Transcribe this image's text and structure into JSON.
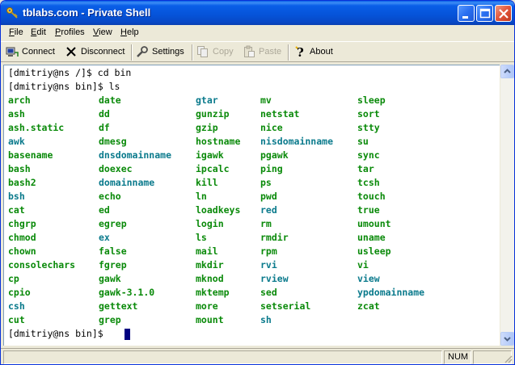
{
  "window": {
    "title": "tblabs.com - Private Shell",
    "key_icon": "key-icon"
  },
  "menu": [
    {
      "label_first": "F",
      "label_rest": "ile"
    },
    {
      "label_first": "E",
      "label_rest": "dit"
    },
    {
      "label_first": "P",
      "label_rest": "rofiles"
    },
    {
      "label_first": "V",
      "label_rest": "iew"
    },
    {
      "label_first": "H",
      "label_rest": "elp"
    }
  ],
  "toolbar": {
    "connect": "Connect",
    "disconnect": "Disconnect",
    "settings": "Settings",
    "copy": "Copy",
    "paste": "Paste",
    "about": "About"
  },
  "terminal": {
    "line1": "[dmitriy@ns /]$ cd bin",
    "line2": "[dmitriy@ns bin]$ ls",
    "prompt": "[dmitriy@ns bin]$ ",
    "listing": [
      [
        {
          "t": "arch",
          "k": "exe"
        },
        {
          "t": "date",
          "k": "exe"
        },
        {
          "t": "gtar",
          "k": "link"
        },
        {
          "t": "mv",
          "k": "exe"
        },
        {
          "t": "sleep",
          "k": "exe"
        }
      ],
      [
        {
          "t": "ash",
          "k": "exe"
        },
        {
          "t": "dd",
          "k": "exe"
        },
        {
          "t": "gunzip",
          "k": "exe"
        },
        {
          "t": "netstat",
          "k": "exe"
        },
        {
          "t": "sort",
          "k": "exe"
        }
      ],
      [
        {
          "t": "ash.static",
          "k": "exe"
        },
        {
          "t": "df",
          "k": "exe"
        },
        {
          "t": "gzip",
          "k": "exe"
        },
        {
          "t": "nice",
          "k": "exe"
        },
        {
          "t": "stty",
          "k": "exe"
        }
      ],
      [
        {
          "t": "awk",
          "k": "link"
        },
        {
          "t": "dmesg",
          "k": "exe"
        },
        {
          "t": "hostname",
          "k": "exe"
        },
        {
          "t": "nisdomainname",
          "k": "link"
        },
        {
          "t": "su",
          "k": "exe"
        }
      ],
      [
        {
          "t": "basename",
          "k": "exe"
        },
        {
          "t": "dnsdomainname",
          "k": "link"
        },
        {
          "t": "igawk",
          "k": "exe"
        },
        {
          "t": "pgawk",
          "k": "exe"
        },
        {
          "t": "sync",
          "k": "exe"
        }
      ],
      [
        {
          "t": "bash",
          "k": "exe"
        },
        {
          "t": "doexec",
          "k": "exe"
        },
        {
          "t": "ipcalc",
          "k": "exe"
        },
        {
          "t": "ping",
          "k": "exe"
        },
        {
          "t": "tar",
          "k": "exe"
        }
      ],
      [
        {
          "t": "bash2",
          "k": "exe"
        },
        {
          "t": "domainname",
          "k": "link"
        },
        {
          "t": "kill",
          "k": "exe"
        },
        {
          "t": "ps",
          "k": "exe"
        },
        {
          "t": "tcsh",
          "k": "exe"
        }
      ],
      [
        {
          "t": "bsh",
          "k": "link"
        },
        {
          "t": "echo",
          "k": "exe"
        },
        {
          "t": "ln",
          "k": "exe"
        },
        {
          "t": "pwd",
          "k": "exe"
        },
        {
          "t": "touch",
          "k": "exe"
        }
      ],
      [
        {
          "t": "cat",
          "k": "exe"
        },
        {
          "t": "ed",
          "k": "exe"
        },
        {
          "t": "loadkeys",
          "k": "exe"
        },
        {
          "t": "red",
          "k": "link"
        },
        {
          "t": "true",
          "k": "exe"
        }
      ],
      [
        {
          "t": "chgrp",
          "k": "exe"
        },
        {
          "t": "egrep",
          "k": "exe"
        },
        {
          "t": "login",
          "k": "exe"
        },
        {
          "t": "rm",
          "k": "exe"
        },
        {
          "t": "umount",
          "k": "exe"
        }
      ],
      [
        {
          "t": "chmod",
          "k": "exe"
        },
        {
          "t": "ex",
          "k": "link"
        },
        {
          "t": "ls",
          "k": "exe"
        },
        {
          "t": "rmdir",
          "k": "exe"
        },
        {
          "t": "uname",
          "k": "exe"
        }
      ],
      [
        {
          "t": "chown",
          "k": "exe"
        },
        {
          "t": "false",
          "k": "exe"
        },
        {
          "t": "mail",
          "k": "exe"
        },
        {
          "t": "rpm",
          "k": "exe"
        },
        {
          "t": "usleep",
          "k": "exe"
        }
      ],
      [
        {
          "t": "consolechars",
          "k": "exe"
        },
        {
          "t": "fgrep",
          "k": "exe"
        },
        {
          "t": "mkdir",
          "k": "exe"
        },
        {
          "t": "rvi",
          "k": "link"
        },
        {
          "t": "vi",
          "k": "exe"
        }
      ],
      [
        {
          "t": "cp",
          "k": "exe"
        },
        {
          "t": "gawk",
          "k": "exe"
        },
        {
          "t": "mknod",
          "k": "exe"
        },
        {
          "t": "rview",
          "k": "link"
        },
        {
          "t": "view",
          "k": "link"
        }
      ],
      [
        {
          "t": "cpio",
          "k": "exe"
        },
        {
          "t": "gawk-3.1.0",
          "k": "exe"
        },
        {
          "t": "mktemp",
          "k": "exe"
        },
        {
          "t": "sed",
          "k": "exe"
        },
        {
          "t": "ypdomainname",
          "k": "link"
        }
      ],
      [
        {
          "t": "csh",
          "k": "link"
        },
        {
          "t": "gettext",
          "k": "exe"
        },
        {
          "t": "more",
          "k": "exe"
        },
        {
          "t": "setserial",
          "k": "exe"
        },
        {
          "t": "zcat",
          "k": "exe"
        }
      ],
      [
        {
          "t": "cut",
          "k": "exe"
        },
        {
          "t": "grep",
          "k": "exe"
        },
        {
          "t": "mount",
          "k": "exe"
        },
        {
          "t": "sh",
          "k": "link"
        },
        {
          "t": "",
          "k": "exe"
        }
      ]
    ]
  },
  "status": {
    "num": "NUM"
  },
  "colors": {
    "executable": "#0a8a0a",
    "symlink": "#0a7a8c",
    "cursor": "#000080"
  }
}
